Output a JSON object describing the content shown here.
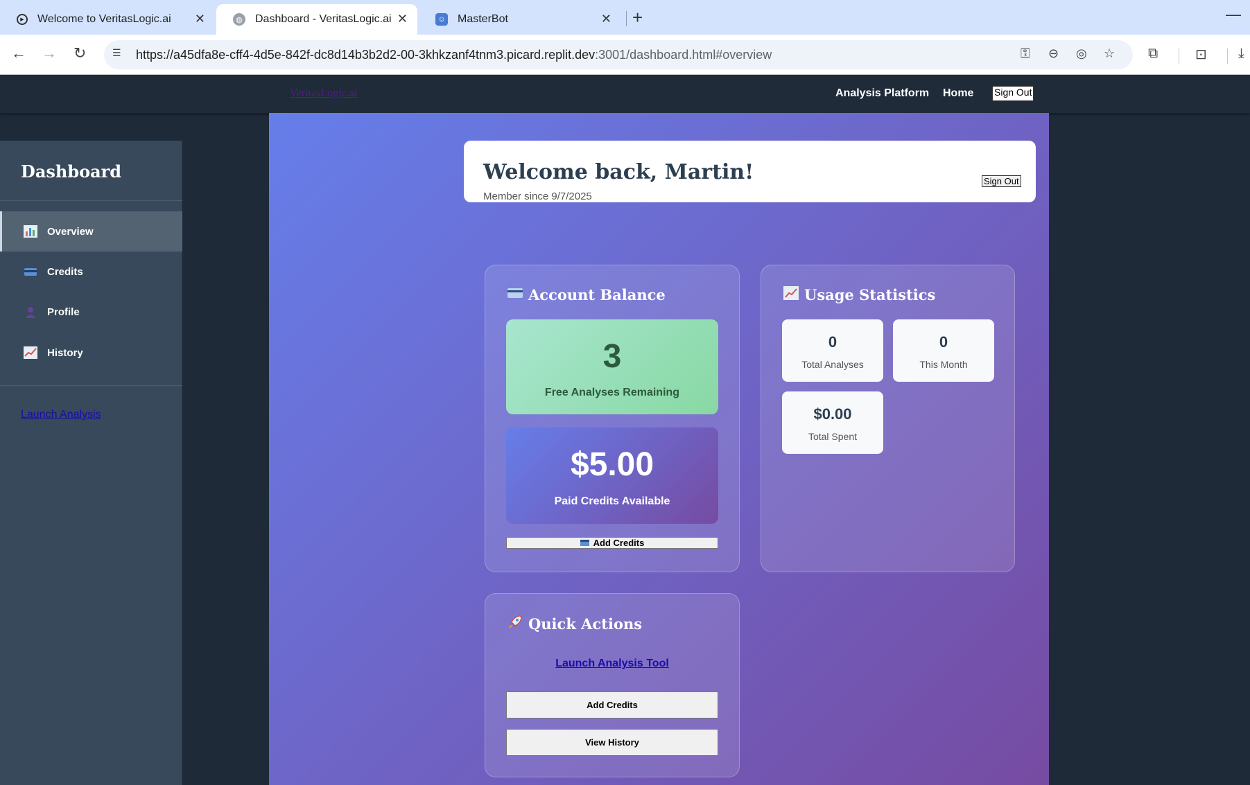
{
  "browser": {
    "tabs": [
      {
        "title": "Welcome to VeritasLogic.ai",
        "active": false
      },
      {
        "title": "Dashboard - VeritasLogic.ai",
        "active": true
      },
      {
        "title": "MasterBot",
        "active": false
      }
    ],
    "url_main": "https://a45dfa8e-cff4-4d5e-842f-dc8d14b3b2d2-00-3khkzanf4tnm3.picard.replit.dev",
    "url_rest": ":3001/dashboard.html#overview"
  },
  "site_nav": {
    "brand": "VeritasLogic.ai",
    "links": [
      "Analysis Platform",
      "Home"
    ],
    "signout": "Sign Out"
  },
  "sidebar": {
    "title": "Dashboard",
    "items": [
      {
        "label": "Overview",
        "icon": "bar-chart-icon",
        "active": true
      },
      {
        "label": "Credits",
        "icon": "credit-card-icon",
        "active": false
      },
      {
        "label": "Profile",
        "icon": "user-icon",
        "active": false
      },
      {
        "label": "History",
        "icon": "trend-chart-icon",
        "active": false
      }
    ],
    "launch_link": "Launch Analysis"
  },
  "welcome": {
    "heading": "Welcome back, Martin!",
    "member_since": "Member since 9/7/2025",
    "signout": "Sign Out"
  },
  "account_balance": {
    "title": "Account Balance",
    "free_count": "3",
    "free_label": "Free Analyses Remaining",
    "paid_amount": "$5.00",
    "paid_label": "Paid Credits Available",
    "add_button": "Add Credits"
  },
  "usage": {
    "title": "Usage Statistics",
    "stats": [
      {
        "value": "0",
        "label": "Total Analyses"
      },
      {
        "value": "0",
        "label": "This Month"
      },
      {
        "value": "$0.00",
        "label": "Total Spent"
      }
    ]
  },
  "quick_actions": {
    "title": "Quick Actions",
    "launch_link": "Launch Analysis Tool",
    "add_button": "Add Credits",
    "history_button": "View History"
  },
  "colors": {
    "gradient_start": "#667eea",
    "gradient_end": "#764ba2",
    "sidebar_bg": "#37495a",
    "free_box": "#a8e6cf"
  }
}
